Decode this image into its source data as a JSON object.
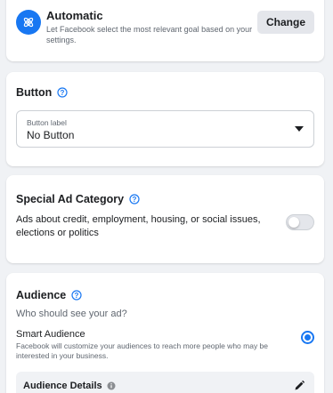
{
  "goal": {
    "title": "Automatic",
    "description": "Let Facebook select the most relevant goal based on your settings.",
    "change_label": "Change"
  },
  "button_section": {
    "title": "Button",
    "field_label": "Button label",
    "field_value": "No Button"
  },
  "special_ad": {
    "title": "Special Ad Category",
    "description": "Ads about credit, employment, housing, or social issues, elections or politics",
    "toggle_on": false
  },
  "audience": {
    "title": "Audience",
    "question": "Who should see your ad?",
    "smart_title": "Smart Audience",
    "smart_description": "Facebook will customize your audiences to reach more people who may be interested in your business.",
    "smart_selected": true,
    "details_title": "Audience Details"
  },
  "colors": {
    "accent": "#1877f2",
    "background": "#f0f2f5"
  }
}
